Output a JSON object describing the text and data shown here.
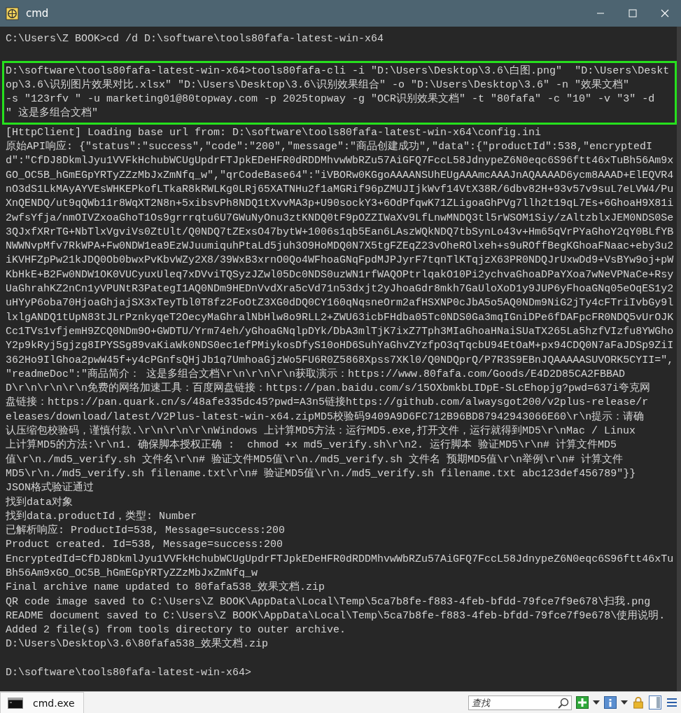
{
  "window": {
    "title": "cmd"
  },
  "console": {
    "lines": [
      {
        "kind": "text",
        "text": "C:\\Users\\Z BOOK>cd /d D:\\software\\tools80fafa-latest-win-x64"
      },
      {
        "kind": "blank"
      },
      {
        "kind": "group",
        "highlighted": true,
        "lines": [
          "D:\\software\\tools80fafa-latest-win-x64>tools80fafa-cli -i \"D:\\Users\\Desktop\\3.6\\白图.png\"  \"D:\\Users\\Deskt",
          "op\\3.6\\识别图片效果对比.xlsx\" \"D:\\Users\\Desktop\\3.6\\识别效果组合\" -o \"D:\\Users\\Desktop\\3.6\" -n \"效果文档\"",
          "-s \"123rfv \" -u marketing01@80topway.com -p 2025topway -g \"OCR识别效果文档\" -t \"80fafa\" -c \"10\" -v \"3\" -d",
          "\" 这是多组合文档\""
        ]
      },
      {
        "kind": "text",
        "text": "[HttpClient] Loading base url from: D:\\software\\tools80fafa-latest-win-x64\\config.ini"
      },
      {
        "kind": "text",
        "text": "原始API响应: {\"status\":\"success\",\"code\":\"200\",\"message\":\"商品创建成功\",\"data\":{\"productId\":538,\"encryptedI"
      },
      {
        "kind": "text",
        "text": "d\":\"CfDJ8DkmlJyu1VVFkHchubWCUgUpdrFTJpkEDeHFR0dRDDMhvwWbRZu57AiGFQ7FccL58JdnypeZ6N0eqc6S96ftt46xTuBh56Am9x"
      },
      {
        "kind": "text",
        "text": "GO_OC5B_hGmEGpYRTyZZzMbJxZmNfq_w\",\"qrCodeBase64\":\"iVBORw0KGgoAAAANSUhEUgAAAmcAAAJnAQAAAAD6ycm8AAAD+ElEQVR4"
      },
      {
        "kind": "text",
        "text": "nO3dS1LkMAyAYVEsWHKEPkofLTkaR8kRWLKg0LRj65XATNHu2f1aMGRif96pZMUJIjkWvf14VtX38R/6dbv82H+93v57v9suL7eLVW4/Pu"
      },
      {
        "kind": "text",
        "text": "XnQENDQ/ut9qQWb11r8WqXT2N8n+5xibsvPh8NDQ1tXvvMA3p+U90sockY3+6OdPfqwK71ZLigoaGhPVg7llh2t19qL7Es+6GhoaH9X81i"
      },
      {
        "kind": "text",
        "text": "2wfsYfja/nmOIVZxoaGhoT1Os9grrrqtu6U7GWuNyOnu3ztKNDQ0tF9pOZZIWaXv9LfLnwMNDQ3tl5rWSOM1Siy/zAltzblxJEM0NDS0Se"
      },
      {
        "kind": "text",
        "text": "3QJxfXRrTG+NbTlxVgviVs0ZtUlt/Q0NDQ7tZExsO47bytW+1006s1qb5Ean6LAszWQkNDQ7tbSynLo43v+Hm65qVrPYaGhoY2qY0BLfYB"
      },
      {
        "kind": "text",
        "text": "NWWNvpMfv7RkWPA+Fw0NDW1ea9EzWJuumiquhPtaLd5juh3O9HoMDQ0N7X5tgFZEqZ23vOheROlxeh+s9uROffBegKGhoaFNaac+eby3u2"
      },
      {
        "kind": "text",
        "text": "iKVHFZpPw21kJDQ0Ob0bwxPvKbvWZy2X8/39WxB3xrnO0Qo4WFhoaGNqFpdMJPJyrF7tqnTlKTqjzX63PR0NDQJrUxwDd9+VsBYw9oj+pW"
      },
      {
        "kind": "text",
        "text": "KbHkE+B2Fw0NDW1OK0VUCyuxUleq7xDVviTQSyzJZwl05Dc0NDS0uzWN1rfWAQOPtrlqakO10Pi2ychvaGhoaDPaYXoa7wNeVPNaCe+Rsy"
      },
      {
        "kind": "text",
        "text": "UaGhrahKZ2nCn1yVPUNtR3PategI1AQ0NDm9HEDnVvdXra5cVd71n53dxjt2yJhoaGdr8mkh7GaUloXoD1y9JUP6yFhoaGNq05eOqES1y2"
      },
      {
        "kind": "text",
        "text": "uHYyP6oba70HjoaGhjajSX3xTeyTbl0T8fz2FoOtZ3XG0dDQ0CY160qNqsneOrm2afHSXNP0cJbA5o5AQ0NDm9NiG2jTy4cFTriIvbGy9l"
      },
      {
        "kind": "text",
        "text": "lxlgANDQ1tUpN83tJLrPznkyqeT2OecyMaGhralNbHlw8o9RLL2+ZWU63icbFHdba05Tc0NDS0Ga3mqIGniDPe6fDAFpcFR0NDQ5vUrOJK"
      },
      {
        "kind": "text",
        "text": "Cc1TVs1vfjemH9ZCQ0NDm9O+GWDTU/Yrm74eh/yGhoaGNqlpDYk/DbA3mlTjK7ixZ7Tph3MIaGhoaHNaiSUaTX265La5hzfVIzfu8YWGho"
      },
      {
        "kind": "text",
        "text": "Y2p9kRyj5gjzg8IPYSSg89vaKiaWk0NDS0ec1efPMiykosDfyS10oHD6SuhYaGhvZYzfpO3qTqcbU94EtOaM+px94CDQ0N7aFaJDSp9ZiI"
      },
      {
        "kind": "text",
        "text": "362Ho9IlGhoa2pwW45f+y4cPGnfsQHjJb1q7UmhoaGjzWo5FU6R0Z5868Xpss7XKl0/Q0NDQprQ/P7R3S9EBnJQAAAAASUVORK5CYII=\","
      },
      {
        "kind": "text",
        "text": "\"readmeDoc\":\"商品简介： 这是多组合文档\\r\\n\\r\\n\\r\\n获取演示：https://www.80fafa.com/Goods/E4D2D85CA2FBBAD"
      },
      {
        "kind": "text",
        "text": "D\\r\\n\\r\\n\\r\\n免费的网络加速工具：百度网盘链接：https://pan.baidu.com/s/15OXbmkbLIDpE-SLcEhopjg?pwd=637i夸克网"
      },
      {
        "kind": "text",
        "text": "盘链接：https://pan.quark.cn/s/48afe335dc45?pwd=A3n5链接https://github.com/alwaysgot200/v2plus-release/r"
      },
      {
        "kind": "text",
        "text": "eleases/download/latest/V2Plus-latest-win-x64.zipMD5校验码9409A9D6FC712B96BD87942943066E60\\r\\n提示：请确"
      },
      {
        "kind": "text",
        "text": "认压缩包校验码，谨慎付款.\\r\\n\\r\\n\\r\\nWindows 上计算MD5方法：运行MD5.exe,打开文件，运行就得到MD5\\r\\nMac / Linux"
      },
      {
        "kind": "text",
        "text": "上计算MD5的方法:\\r\\n1. 确保脚本授权正确 :  chmod +x md5_verify.sh\\r\\n2. 运行脚本 验证MD5\\r\\n# 计算文件MD5"
      },
      {
        "kind": "text",
        "text": "值\\r\\n./md5_verify.sh 文件名\\r\\n# 验证文件MD5值\\r\\n./md5_verify.sh 文件名 预期MD5值\\r\\n举例\\r\\n# 计算文件"
      },
      {
        "kind": "text",
        "text": "MD5\\r\\n./md5_verify.sh filename.txt\\r\\n# 验证MD5值\\r\\n./md5_verify.sh filename.txt abc123def456789\"}}"
      },
      {
        "kind": "text",
        "text": "JSON格式验证通过"
      },
      {
        "kind": "text",
        "text": "找到data对象"
      },
      {
        "kind": "text",
        "text": "找到data.productId，类型: Number"
      },
      {
        "kind": "text",
        "text": "已解析响应: ProductId=538, Message=success:200"
      },
      {
        "kind": "text",
        "text": "Product created. Id=538, Message=success:200"
      },
      {
        "kind": "text",
        "text": "EncryptedId=CfDJ8DkmlJyu1VVFkHchubWCUgUpdrFTJpkEDeHFR0dRDDMhvwWbRZu57AiGFQ7FccL58JdnypeZ6N0eqc6S96ftt46xTu"
      },
      {
        "kind": "text",
        "text": "Bh56Am9xGO_OC5B_hGmEGpYRTyZZzMbJxZmNfq_w"
      },
      {
        "kind": "text",
        "text": "Final archive name updated to 80fafa538_效果文档.zip"
      },
      {
        "kind": "text",
        "text": "QR code image saved to C:\\Users\\Z BOOK\\AppData\\Local\\Temp\\5ca7b8fe-f883-4feb-bfdd-79fce7f9e678\\扫我.png"
      },
      {
        "kind": "text",
        "text": "README document saved to C:\\Users\\Z BOOK\\AppData\\Local\\Temp\\5ca7b8fe-f883-4feb-bfdd-79fce7f9e678\\使用说明."
      },
      {
        "kind": "text",
        "text": "Added 2 file(s) from tools directory to outer archive."
      },
      {
        "kind": "text",
        "text": "D:\\Users\\Desktop\\3.6\\80fafa538_效果文档.zip"
      },
      {
        "kind": "blank"
      },
      {
        "kind": "text",
        "text": "D:\\software\\tools80fafa-latest-win-x64>"
      }
    ]
  },
  "taskbar": {
    "task": "cmd.exe",
    "search": {
      "placeholder": "查找"
    }
  }
}
